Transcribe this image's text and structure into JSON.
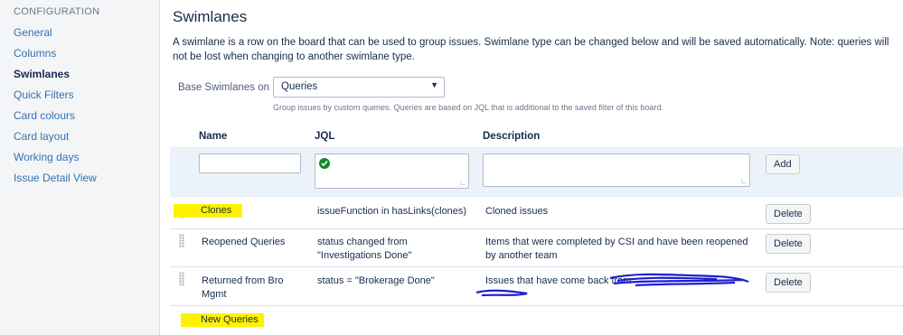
{
  "sidebar": {
    "section_title": "CONFIGURATION",
    "items": [
      {
        "label": "General",
        "active": false
      },
      {
        "label": "Columns",
        "active": false
      },
      {
        "label": "Swimlanes",
        "active": true
      },
      {
        "label": "Quick Filters",
        "active": false
      },
      {
        "label": "Card colours",
        "active": false
      },
      {
        "label": "Card layout",
        "active": false
      },
      {
        "label": "Working days",
        "active": false
      },
      {
        "label": "Issue Detail View",
        "active": false
      }
    ]
  },
  "page": {
    "title": "Swimlanes",
    "description": "A swimlane is a row on the board that can be used to group issues. Swimlane type can be changed below and will be saved automatically. Note: queries will not be lost when changing to another swimlane type."
  },
  "base_swimlanes": {
    "label": "Base Swimlanes on",
    "selected": "Queries",
    "hint": "Group issues by custom queries. Queries are based on JQL that is additional to the saved filter of this board."
  },
  "table": {
    "headers": {
      "name": "Name",
      "jql": "JQL",
      "description": "Description"
    },
    "add_button": "Add",
    "delete_button": "Delete",
    "rows": [
      {
        "name": "Clones",
        "jql": "issueFunction in hasLinks(clones)",
        "description": "Cloned issues"
      },
      {
        "name": "Reopened Queries",
        "jql": "status changed from \"Investigations Done\"",
        "description": "Items that were completed by CSI and have been reopened by another team"
      },
      {
        "name": "Returned from Bro Mgmt",
        "jql": "status = \"Brokerage Done\"",
        "description": "Issues that have come back from"
      }
    ],
    "new_row_name": "New Queries"
  },
  "colors": {
    "highlight": "#fff200",
    "scribble": "#1f1fd0",
    "link": "#3572b0"
  }
}
